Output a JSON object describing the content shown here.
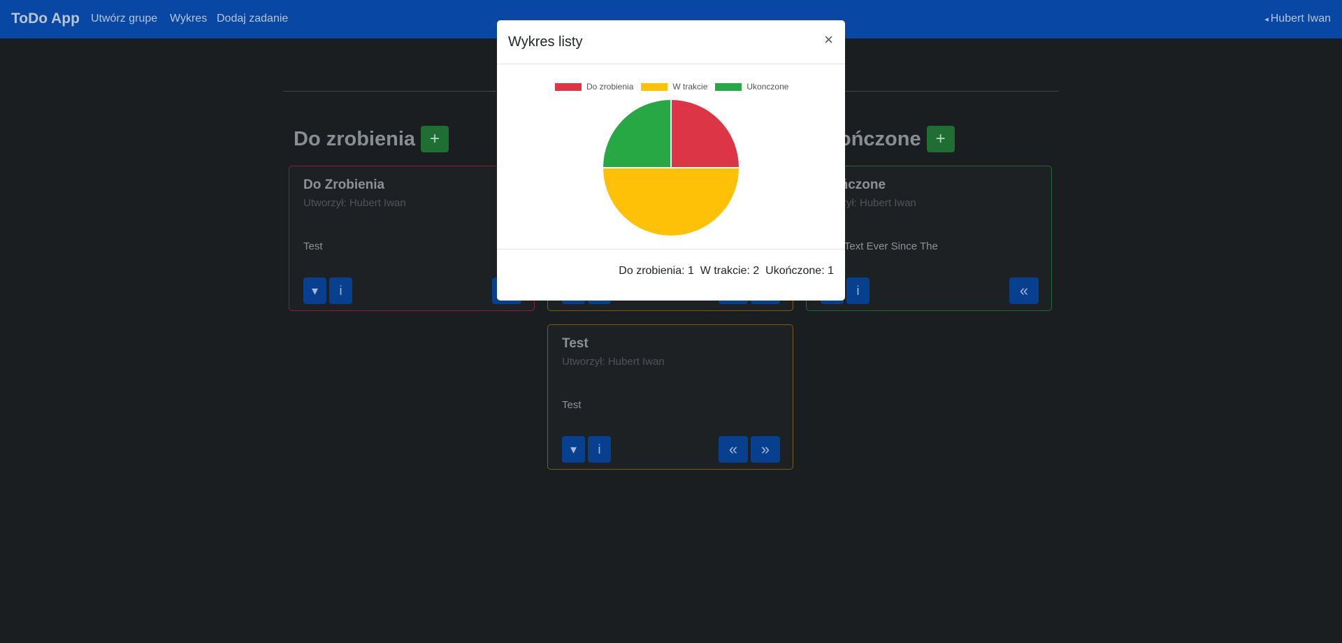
{
  "navbar": {
    "brand": "ToDo App",
    "links": [
      "Utwórz grupe",
      "Wykres",
      "Dodaj zadanie"
    ],
    "user": "Hubert Iwan"
  },
  "columns": {
    "todo": {
      "heading": "Do zrobienia",
      "add": "+"
    },
    "done": {
      "heading": "ończone",
      "add": "+"
    }
  },
  "cards": {
    "todo": {
      "title": "Do Zrobienia",
      "author": "Utworzył: Hubert Iwan",
      "body": "Test"
    },
    "progress": {
      "title": "Test",
      "author": "Utworzył: Hubert Iwan",
      "body": "Test"
    },
    "done": {
      "title": "ończone",
      "author": "orzył: Hubert Iwan",
      "body": "my Text Ever Since The"
    }
  },
  "icons": {
    "dropdown": "▾",
    "info": "i",
    "back": "«",
    "forward": "»"
  },
  "colors": {
    "todo": "#dc3545",
    "progress": "#ffc107",
    "done": "#28a745",
    "navbar": "#0847a3",
    "button": "#08408f",
    "add": "#1f6e33"
  },
  "modal": {
    "title": "Wykres listy",
    "close": "×",
    "summary": "Do zrobienia: 1  W trakcie: 2  Ukończone: 1"
  },
  "chart_data": {
    "type": "pie",
    "categories": [
      "Do zrobienia",
      "W trakcie",
      "Ukonczone"
    ],
    "values": [
      1,
      2,
      1
    ],
    "colors": [
      "#dc3545",
      "#ffc107",
      "#28a745"
    ],
    "legend": "top"
  }
}
